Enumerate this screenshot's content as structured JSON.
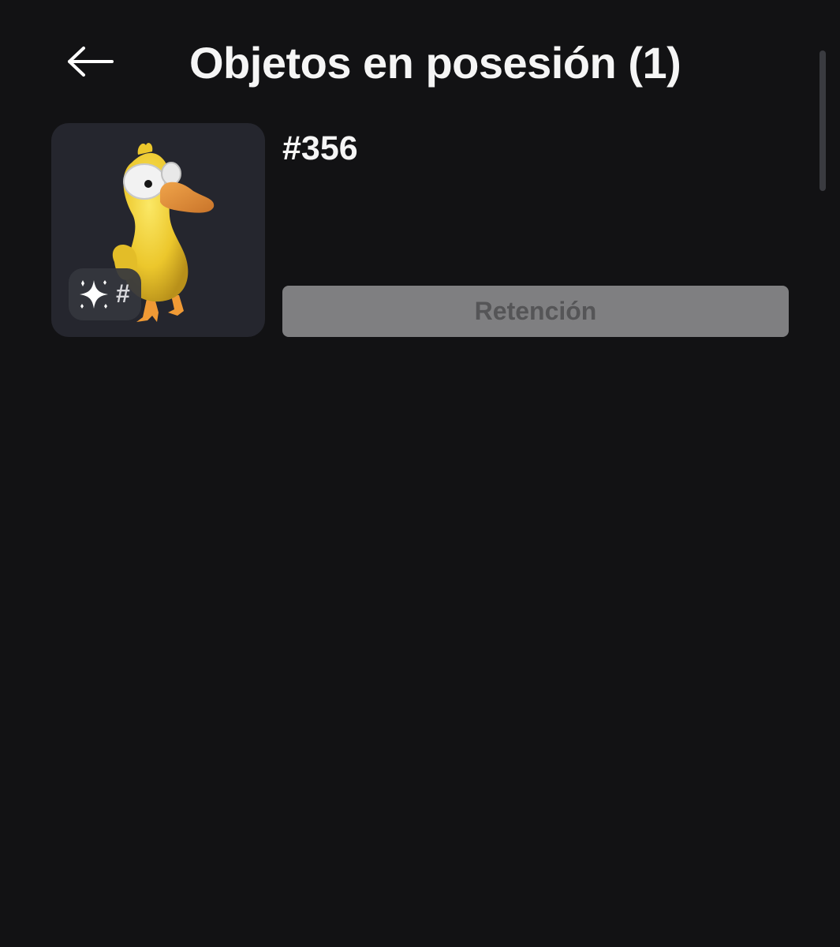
{
  "header": {
    "back_icon": "arrow-left-icon",
    "title": "Objetos en posesión (1)"
  },
  "item": {
    "image_name": "yellow-duck-icon",
    "badge": {
      "icon": "sparkles-icon",
      "label": "#"
    },
    "serial": "#356",
    "button_label": "Retención"
  },
  "colors": {
    "background": "#121214",
    "thumbnail_bg": "#25262e",
    "button_disabled_bg": "#7f7f81",
    "button_disabled_text": "#555557",
    "duck_body": "#f2d33a",
    "duck_beak": "#e8973a"
  }
}
